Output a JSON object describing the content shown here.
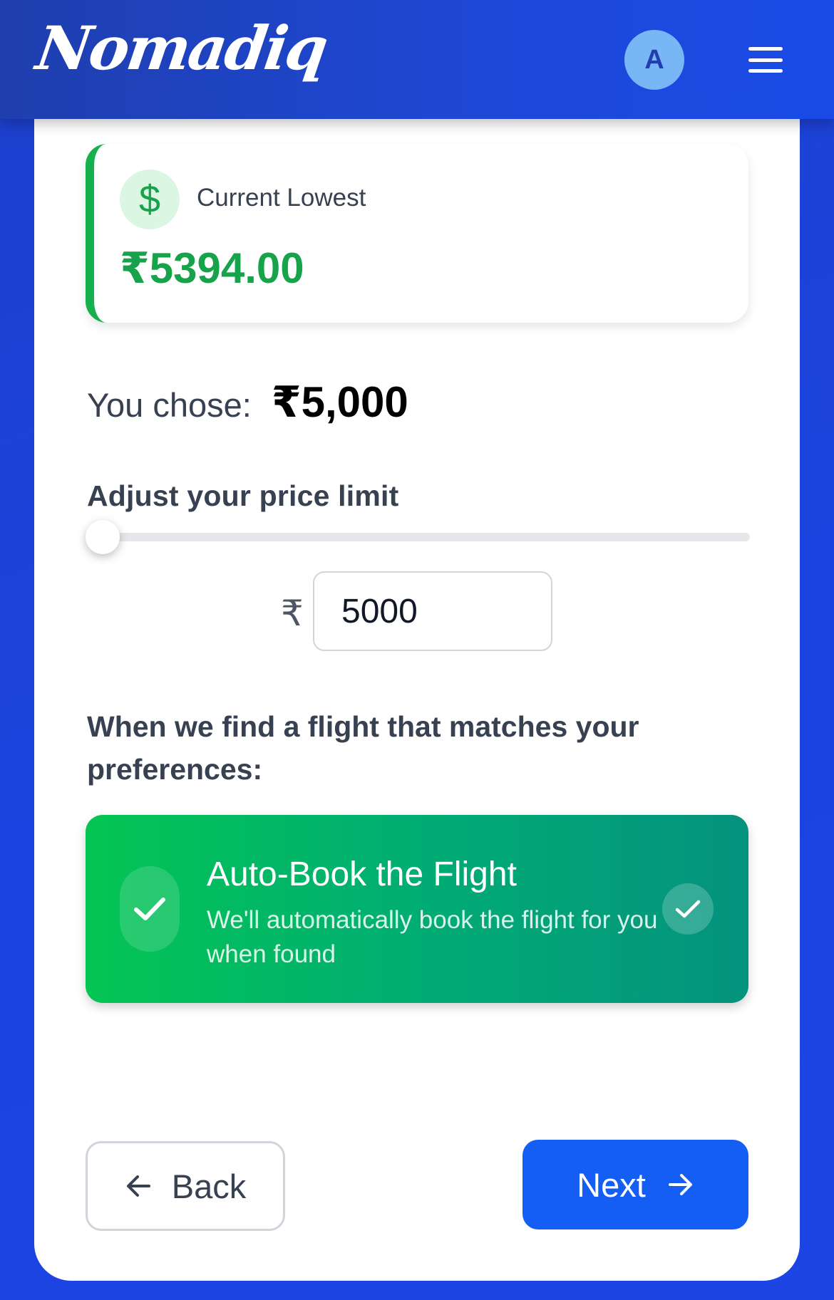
{
  "header": {
    "logo_text": "Nomadiq",
    "avatar_initial": "A",
    "menu_icon": "hamburger-menu-icon"
  },
  "lowest": {
    "icon": "dollar-icon",
    "label": "Current Lowest",
    "value": "₹5394.00",
    "accent": "#16a34a"
  },
  "chose": {
    "label": "You chose:",
    "value": "₹5,000"
  },
  "price_limit": {
    "label": "Adjust your price limit",
    "slider_fraction": 0.0,
    "currency_symbol": "₹",
    "input_value": "5000"
  },
  "preferences": {
    "prompt": "When we find a flight that matches your preferences:",
    "option": {
      "title": "Auto-Book the Flight",
      "description": "We'll automatically book the flight for you when found",
      "selected": true,
      "icon": "checkmark-icon"
    }
  },
  "nav": {
    "back_label": "Back",
    "next_label": "Next",
    "primary_color": "#145ef3"
  }
}
